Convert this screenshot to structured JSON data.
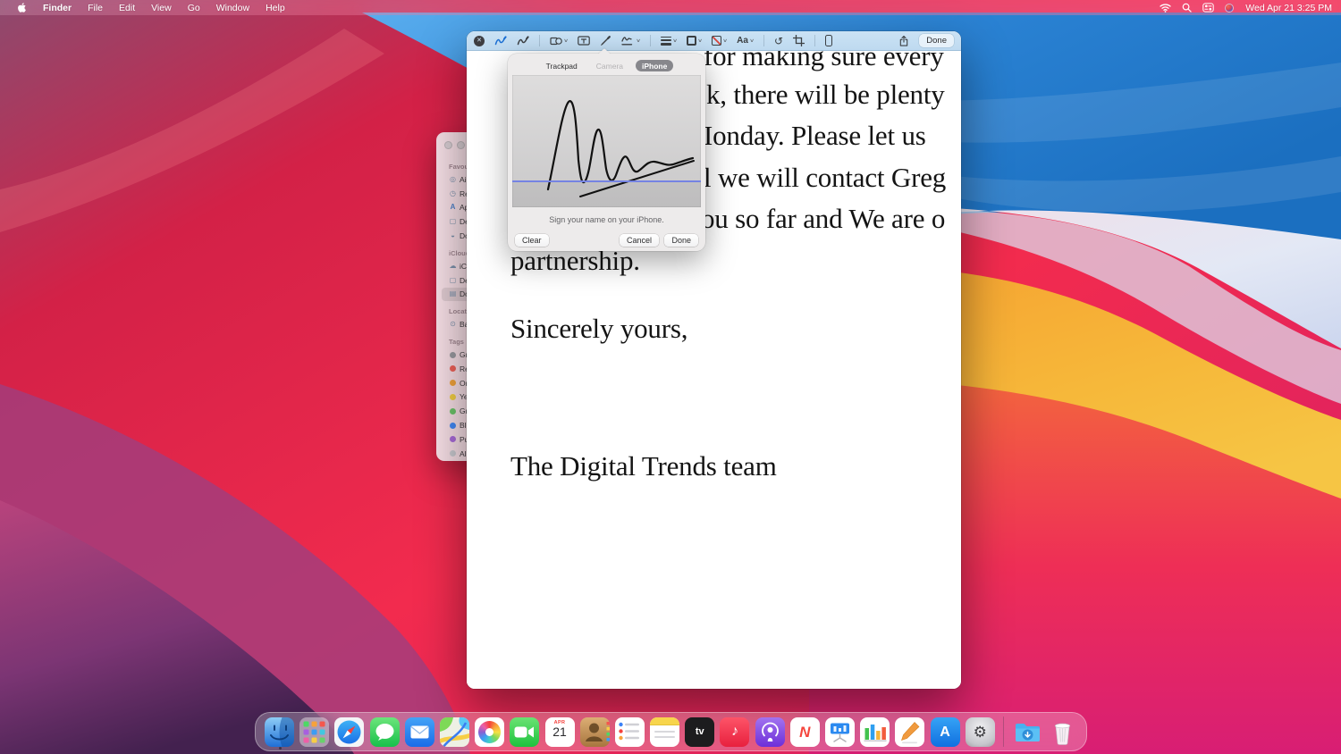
{
  "menu_bar": {
    "app_menu_items": [
      "Finder",
      "File",
      "Edit",
      "View",
      "Go",
      "Window",
      "Help"
    ],
    "active_app": "Finder",
    "status_icons": [
      "wifi-icon",
      "search-icon",
      "control-center-icon",
      "status-orb-icon"
    ],
    "clock": "Wed Apr 21  3:25 PM"
  },
  "markup_toolbar": {
    "icons": [
      "close",
      "sketch",
      "draw",
      "shapes",
      "text-box",
      "pen",
      "signature",
      "line-weight",
      "border-color",
      "fill-color",
      "text-style",
      "rotate-left",
      "crop",
      "iphone",
      "share"
    ],
    "text_style_label": "Aa",
    "done_label": "Done"
  },
  "document": {
    "lines": [
      "for making sure every",
      "k, there will be plenty",
      "Ionday. Please let us",
      "l we will contact Greg",
      "ou so far and We are o",
      "partnership.",
      "Sincerely yours,",
      "The Digital Trends team"
    ]
  },
  "signature_popover": {
    "tabs": [
      {
        "label": "Trackpad",
        "state": "normal"
      },
      {
        "label": "Camera",
        "state": "disabled"
      },
      {
        "label": "iPhone",
        "state": "selected"
      }
    ],
    "caption": "Sign your name on your iPhone.",
    "clear_label": "Clear",
    "cancel_label": "Cancel",
    "done_label": "Done",
    "signature_line_color": "#7583e3"
  },
  "finder": {
    "sections": [
      {
        "title": "Favourites",
        "items": [
          {
            "label": "AirDr",
            "icon": "airdrop-icon"
          },
          {
            "label": "Rece",
            "icon": "recents-icon"
          },
          {
            "label": "Appli",
            "icon": "applications-icon"
          },
          {
            "label": "Desk",
            "icon": "desktop-icon"
          },
          {
            "label": "Dow",
            "icon": "downloads-icon"
          }
        ]
      },
      {
        "title": "iCloud",
        "items": [
          {
            "label": "iClou",
            "icon": "icloud-icon"
          },
          {
            "label": "Desk",
            "icon": "desktop-icon"
          },
          {
            "label": "Docu",
            "icon": "documents-icon",
            "selected": true
          }
        ]
      },
      {
        "title": "Locations",
        "items": [
          {
            "label": "Back",
            "icon": "disk-icon"
          }
        ]
      },
      {
        "title": "Tags",
        "items": [
          {
            "label": "Grey",
            "color": "#9a9aa0"
          },
          {
            "label": "Red",
            "color": "#ee6158"
          },
          {
            "label": "Oran",
            "color": "#f2a33c"
          },
          {
            "label": "Yello",
            "color": "#f2ce45"
          },
          {
            "label": "Gree",
            "color": "#6cc46a"
          },
          {
            "label": "Blue",
            "color": "#4288f5"
          },
          {
            "label": "Purp",
            "color": "#a96bd8"
          },
          {
            "label": "All T",
            "color": "#c9c9cf"
          }
        ]
      }
    ]
  },
  "dock": {
    "apps": [
      "finder",
      "launchpad",
      "safari",
      "messages",
      "mail",
      "maps",
      "photos",
      "facetime",
      "calendar",
      "contacts",
      "reminders",
      "notes",
      "tv",
      "music",
      "podcasts",
      "news",
      "keynote",
      "numbers",
      "pages",
      "app-store",
      "system-preferences",
      "downloads-folder",
      "trash"
    ],
    "calendar_month": "APR",
    "calendar_day": "21",
    "tv_label": "tv",
    "news_letter": "N",
    "appstore_letter": "A",
    "music_glyph": "♪",
    "settings_glyph": "⚙"
  },
  "colors": {
    "accent_blue": "#1a6fd4",
    "toolbar_bg": "#c3ddf1",
    "wallpaper_red": "#f1294e",
    "wallpaper_blue": "#2b83d4",
    "wallpaper_orange": "#f5a030"
  }
}
